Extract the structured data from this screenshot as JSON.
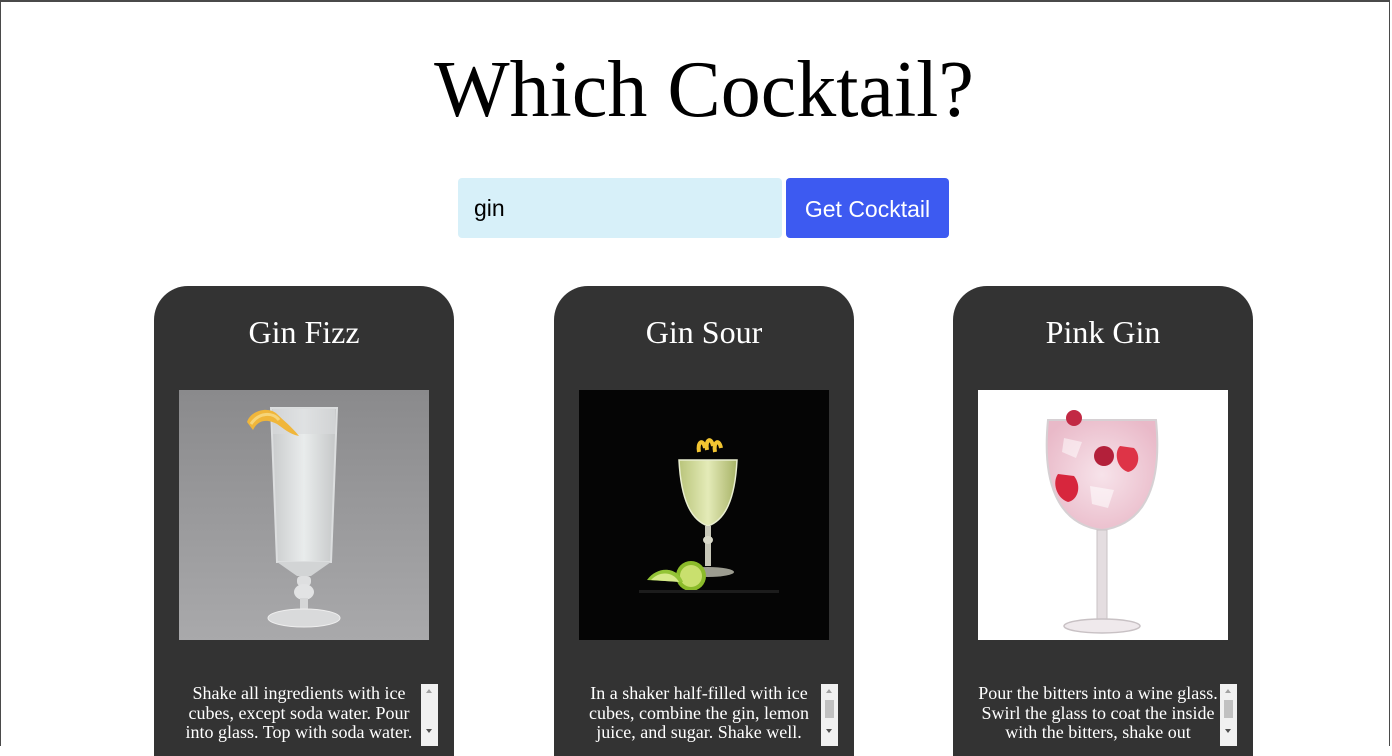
{
  "header": {
    "title": "Which Cocktail?"
  },
  "search": {
    "value": "gin",
    "placeholder": "",
    "button_label": "Get Cocktail"
  },
  "colors": {
    "input_bg": "#d7f0f9",
    "button_bg": "#3d5af1",
    "card_bg": "#333333"
  },
  "results": [
    {
      "name": "Gin Fizz",
      "image_icon": "gin-fizz-photo",
      "instructions": "Shake all ingredients with ice cubes, except soda water. Pour into glass. Top with soda water."
    },
    {
      "name": "Gin Sour",
      "image_icon": "gin-sour-photo",
      "instructions": "In a shaker half-filled with ice cubes, combine the gin, lemon juice, and sugar. Shake well."
    },
    {
      "name": "Pink Gin",
      "image_icon": "pink-gin-photo",
      "instructions": "Pour the bitters into a wine glass. Swirl the glass to coat the inside with the bitters, shake out"
    }
  ]
}
